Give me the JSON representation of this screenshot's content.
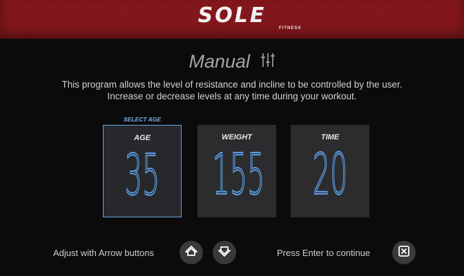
{
  "brand": {
    "name": "SOLE",
    "sub": "FITNESS"
  },
  "program": {
    "title": "Manual",
    "description_line1": "This program allows the level of resistance and incline to be controlled by the user.",
    "description_line2": "Increase or decrease levels at any time during your workout."
  },
  "selection_hint": "SELECT AGE",
  "fields": [
    {
      "label": "AGE",
      "value": "35",
      "selected": true
    },
    {
      "label": "WEIGHT",
      "value": "155",
      "selected": false
    },
    {
      "label": "TIME",
      "value": "20",
      "selected": false
    }
  ],
  "footer": {
    "adjust_label": "Adjust with Arrow buttons",
    "enter_label": "Press Enter to continue"
  },
  "icons": {
    "program": "sliders-icon",
    "up": "chevron-up-icon",
    "down": "chevron-down-icon",
    "enter": "enter-icon"
  },
  "colors": {
    "header": "#8a1a1f",
    "accent_blue": "#5c9fe6",
    "card": "#2c2c2e",
    "background": "#0b0b0b"
  }
}
